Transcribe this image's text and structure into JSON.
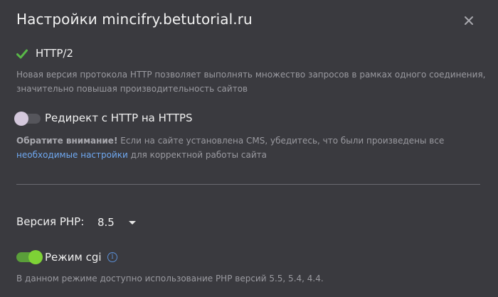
{
  "dialog": {
    "title": "Настройки mincifry.betutorial.ru",
    "close_icon": "close-icon"
  },
  "http2": {
    "label": "HTTP/2",
    "enabled": true,
    "icon": "checkmark-icon",
    "color": "#59b848",
    "description": "Новая версия протокола HTTP позволяет выполнять множество запросов в рамках одного соединения, значительно повышая производительность сайтов"
  },
  "https_redirect": {
    "label": "Редирект с HTTP на HTTPS",
    "enabled": false,
    "note_bold": "Обратите внимание!",
    "note_text": " Если на сайте установлена CMS, убедитесь, что были произведены все ",
    "note_link": "необходимые настройки",
    "note_tail": " для корректной работы сайта"
  },
  "php": {
    "label": "Версия PHP:",
    "value": "8.5"
  },
  "cgi": {
    "label": "Режим cgi",
    "enabled": true,
    "info_icon": "info-icon",
    "description": "В данном режиме доступно использование PHP версий 5.5, 5.4, 4.4."
  },
  "colors": {
    "background": "#3a3a3f",
    "accent_green": "#7ed236",
    "link": "#6fa8f0"
  }
}
